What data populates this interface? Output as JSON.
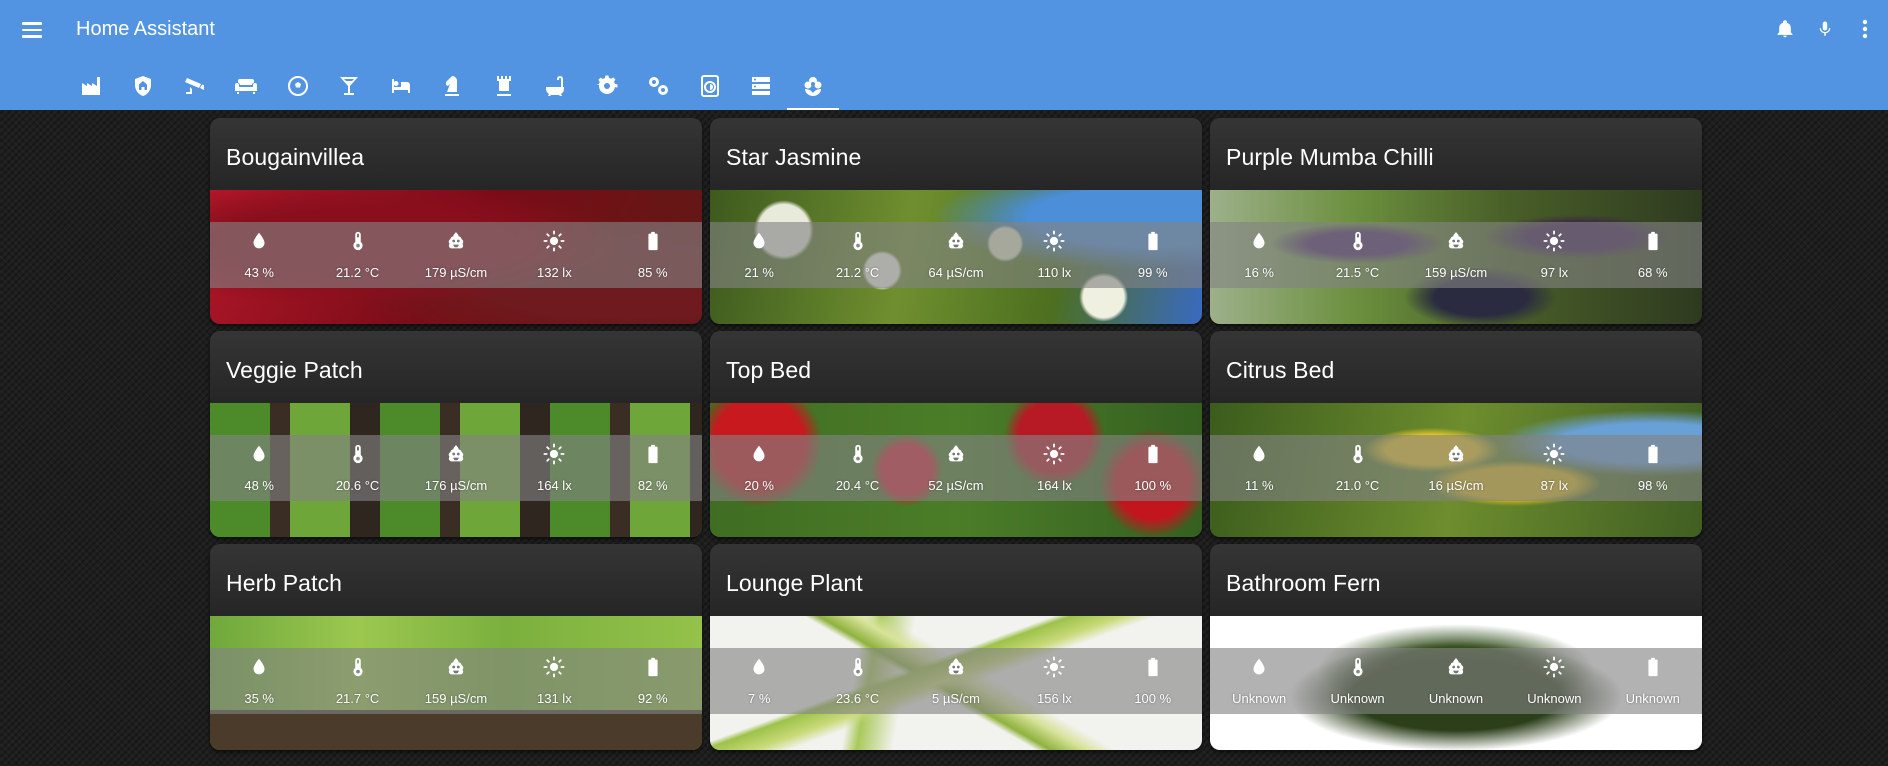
{
  "header": {
    "title": "Home Assistant",
    "tabs": [
      {
        "icon": "factory-icon"
      },
      {
        "icon": "shield-home-icon"
      },
      {
        "icon": "cctv-icon"
      },
      {
        "icon": "sofa-icon"
      },
      {
        "icon": "soccer-icon"
      },
      {
        "icon": "glass-cocktail-icon"
      },
      {
        "icon": "bed-icon"
      },
      {
        "icon": "chess-knight-icon"
      },
      {
        "icon": "chess-rook-icon"
      },
      {
        "icon": "bathtub-icon"
      },
      {
        "icon": "cog-icon"
      },
      {
        "icon": "cogs-icon"
      },
      {
        "icon": "washing-machine-icon"
      },
      {
        "icon": "server-icon"
      },
      {
        "icon": "flower-icon",
        "active": true
      }
    ],
    "right_icons": [
      "bell-icon",
      "microphone-icon",
      "dots-vertical-icon"
    ],
    "accent_color": "#5294e2"
  },
  "sensor_icons": [
    "water-drop-icon",
    "thermometer-icon",
    "fertilizer-icon",
    "sun-icon",
    "battery-icon"
  ],
  "plants": [
    {
      "name": "Bougainvillea",
      "image": "bougainvillea",
      "values": [
        "43 %",
        "21.2 °C",
        "179 µS/cm",
        "132 lx",
        "85 %"
      ]
    },
    {
      "name": "Star Jasmine",
      "image": "star",
      "values": [
        "21 %",
        "21.2 °C",
        "64 µS/cm",
        "110 lx",
        "99 %"
      ]
    },
    {
      "name": "Purple Mumba Chilli",
      "image": "chilli",
      "values": [
        "16 %",
        "21.5 °C",
        "159 µS/cm",
        "97 lx",
        "68 %"
      ]
    },
    {
      "name": "Veggie Patch",
      "image": "veggie",
      "values": [
        "48 %",
        "20.6 °C",
        "176 µS/cm",
        "164 lx",
        "82 %"
      ]
    },
    {
      "name": "Top Bed",
      "image": "topbed",
      "values": [
        "20 %",
        "20.4 °C",
        "52 µS/cm",
        "164 lx",
        "100 %"
      ]
    },
    {
      "name": "Citrus Bed",
      "image": "citrus",
      "values": [
        "11 %",
        "21.0 °C",
        "16 µS/cm",
        "87 lx",
        "98 %"
      ]
    },
    {
      "name": "Herb Patch",
      "image": "herb",
      "values": [
        "35 %",
        "21.7 °C",
        "159 µS/cm",
        "131 lx",
        "92 %"
      ]
    },
    {
      "name": "Lounge Plant",
      "image": "lounge",
      "values": [
        "7 %",
        "23.6 °C",
        "5 µS/cm",
        "156 lx",
        "100 %"
      ]
    },
    {
      "name": "Bathroom Fern",
      "image": "fern",
      "values": [
        "Unknown",
        "Unknown",
        "Unknown",
        "Unknown",
        "Unknown"
      ]
    }
  ]
}
